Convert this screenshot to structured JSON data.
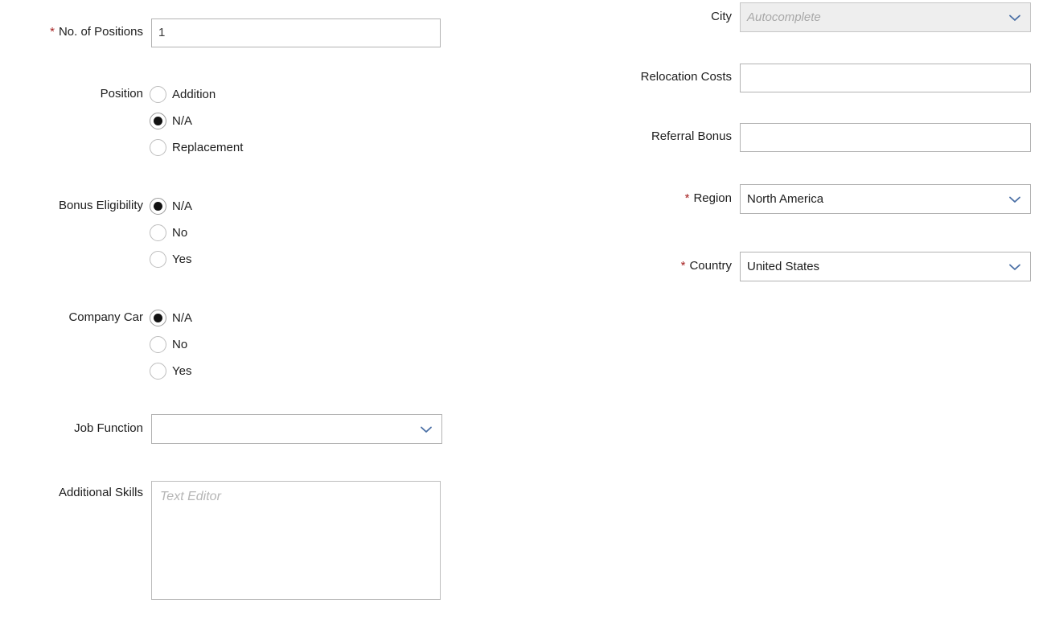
{
  "form": {
    "left_column": {
      "no_of_positions": {
        "label": "No. of Positions",
        "required_marker": "*",
        "value": "1"
      },
      "position": {
        "label": "Position",
        "options": [
          {
            "label": "Addition",
            "selected": false
          },
          {
            "label": "N/A",
            "selected": true
          },
          {
            "label": "Replacement",
            "selected": false
          }
        ]
      },
      "bonus_eligibility": {
        "label": "Bonus Eligibility",
        "options": [
          {
            "label": "N/A",
            "selected": true
          },
          {
            "label": "No",
            "selected": false
          },
          {
            "label": "Yes",
            "selected": false
          }
        ]
      },
      "company_car": {
        "label": "Company Car",
        "options": [
          {
            "label": "N/A",
            "selected": true
          },
          {
            "label": "No",
            "selected": false
          },
          {
            "label": "Yes",
            "selected": false
          }
        ]
      },
      "job_function": {
        "label": "Job Function",
        "value": "",
        "icon": "chevron-down-icon"
      },
      "additional_skills": {
        "label": "Additional Skills",
        "placeholder": "Text Editor",
        "value": ""
      }
    },
    "right_column": {
      "city": {
        "label": "City",
        "placeholder": "Autocomplete",
        "value": "",
        "disabled": true,
        "icon": "chevron-down-icon"
      },
      "relocation_costs": {
        "label": "Relocation Costs",
        "value": ""
      },
      "referral_bonus": {
        "label": "Referral Bonus",
        "value": ""
      },
      "region": {
        "label": "Region",
        "required_marker": "*",
        "value": "North America",
        "icon": "chevron-down-icon"
      },
      "country": {
        "label": "Country",
        "required_marker": "*",
        "value": "United States",
        "icon": "chevron-down-icon"
      }
    }
  },
  "colors": {
    "required_asterisk": "#a62020",
    "chevron": "#4a6fa5",
    "border": "#b3b3b3",
    "disabled_bg": "#eeeeee",
    "placeholder": "#b0b0b0",
    "text": "#1d1d1d"
  }
}
